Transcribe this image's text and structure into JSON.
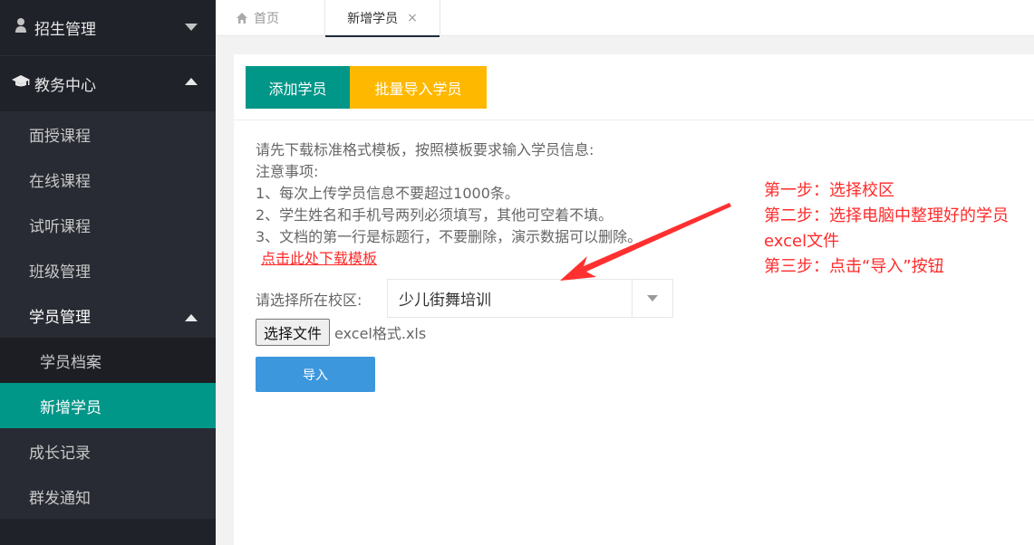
{
  "sidebar": {
    "groups": [
      {
        "label": "招生管理",
        "icon": "user-icon",
        "expanded": false
      },
      {
        "label": "教务中心",
        "icon": "graduation-cap-icon",
        "expanded": true
      }
    ],
    "items": [
      {
        "label": "面授课程"
      },
      {
        "label": "在线课程"
      },
      {
        "label": "试听课程"
      },
      {
        "label": "班级管理"
      },
      {
        "label": "学员管理",
        "expanded": true
      },
      {
        "label": "成长记录"
      },
      {
        "label": "群发通知"
      }
    ],
    "subitems": [
      {
        "label": "学员档案",
        "active": false
      },
      {
        "label": "新增学员",
        "active": true
      }
    ]
  },
  "tabs": {
    "home": {
      "label": "首页",
      "icon": "home-icon"
    },
    "active": {
      "label": "新增学员",
      "close": "×"
    }
  },
  "toolbar": {
    "add_label": "添加学员",
    "batch_label": "批量导入学员"
  },
  "notes": {
    "intro": "请先下载标准格式模板，按照模板要求输入学员信息:",
    "title": "注意事项:",
    "lines": [
      "1、每次上传学员信息不要超过1000条。",
      "2、学生姓名和手机号两列必须填写，其他可空着不填。",
      "3、文档的第一行是标题行，不要删除，演示数据可以删除。"
    ],
    "download_link": "点击此处下载模板"
  },
  "form": {
    "campus_label": "请选择所在校区:",
    "campus_value": "少儿街舞培训",
    "file_button": "选择文件",
    "file_name": "excel格式.xls",
    "import_label": "导入"
  },
  "annotation": {
    "steps": [
      "第一步：选择校区",
      "第二步：选择电脑中整理好的学员excel文件",
      "第三步：点击“导入”按钮"
    ],
    "color": "#ff2a2a"
  },
  "colors": {
    "sidebar_bg": "#20222a",
    "active": "#009688",
    "batch": "#ffb800",
    "import": "#3d97dd"
  }
}
